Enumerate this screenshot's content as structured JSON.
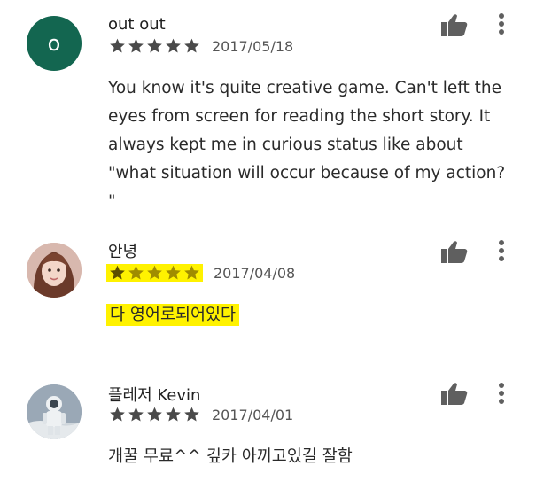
{
  "reviews": [
    {
      "author": "out out",
      "avatar_letter": "o",
      "avatar_color": "#136650",
      "rating": 5,
      "date": "2017/05/18",
      "text": "You know it's quite creative game. Can't left the eyes from screen for reading the short story. It always kept me in curious status like about \"what situation will occur because of my action? \""
    },
    {
      "author": "안녕",
      "avatar_type": "photo",
      "rating": 5,
      "date": "2017/04/08",
      "text": "다 영어로되어있다",
      "highlighted": true
    },
    {
      "author": "플레저 Kevin",
      "avatar_type": "photo",
      "rating": 5,
      "date": "2017/04/01",
      "text": "개꿀 무료^^ 깊카 아끼고있길 잘함"
    }
  ],
  "icons": {
    "like": "thumbs-up-icon",
    "more": "more-vert-icon",
    "star": "star-icon"
  },
  "colors": {
    "highlight": "#fff200",
    "star": "#4a4a4a",
    "star_highlighted": "#a08c00"
  }
}
